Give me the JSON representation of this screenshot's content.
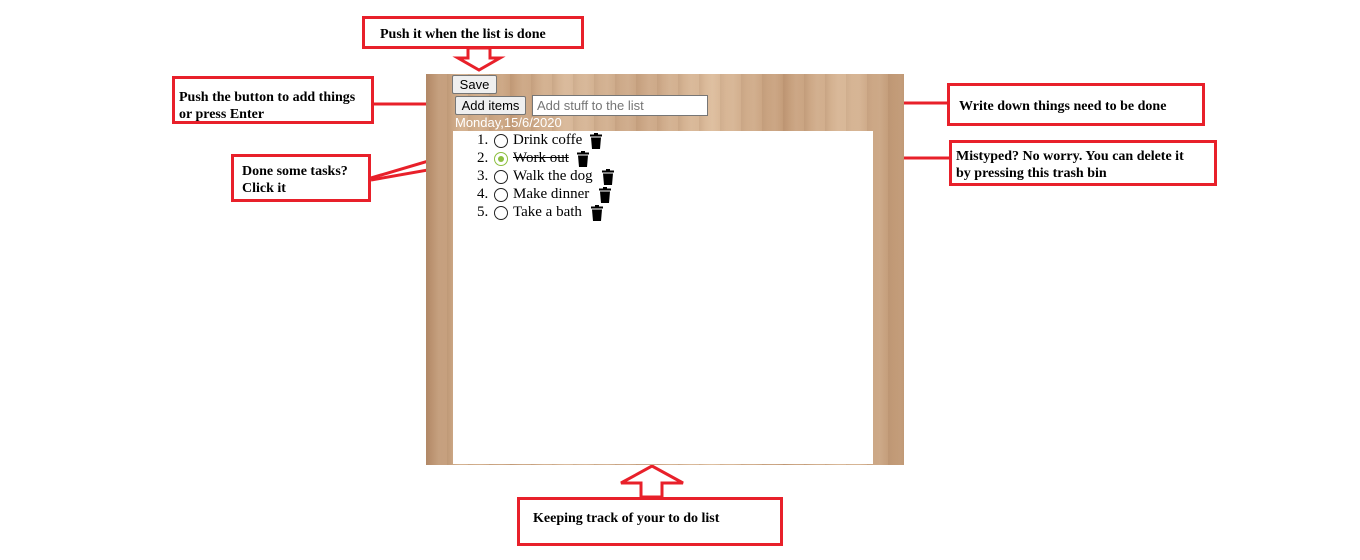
{
  "app": {
    "save_label": "Save",
    "add_items_label": "Add items",
    "input_placeholder": "Add stuff to the list",
    "input_value": "",
    "date": "Monday,15/6/2020",
    "items": [
      {
        "number": "1.",
        "text": "Drink coffe",
        "done": false
      },
      {
        "number": "2.",
        "text": "Work out",
        "done": true
      },
      {
        "number": "3.",
        "text": "Walk the dog",
        "done": false
      },
      {
        "number": "4.",
        "text": "Make dinner",
        "done": false
      },
      {
        "number": "5.",
        "text": "Take a bath",
        "done": false
      }
    ]
  },
  "annotations": {
    "save": "Push it when the list is done",
    "add_line1": "Push the button to add things",
    "add_line2": "or press Enter",
    "write": "Write down things need to be done",
    "done_line1": "Done some tasks?",
    "done_line2": "Click it",
    "delete_line1": "Mistyped? No worry. You can delete it",
    "delete_line2": "by pressing this trash bin",
    "track": "Keeping track of your to do list"
  },
  "colors": {
    "annotation_border": "#e8202a",
    "checked_radio": "#8cbf3f",
    "board_wood": "#c9a381"
  },
  "icons": {
    "trash": "trash-icon",
    "radio": "radio-circle-icon"
  }
}
